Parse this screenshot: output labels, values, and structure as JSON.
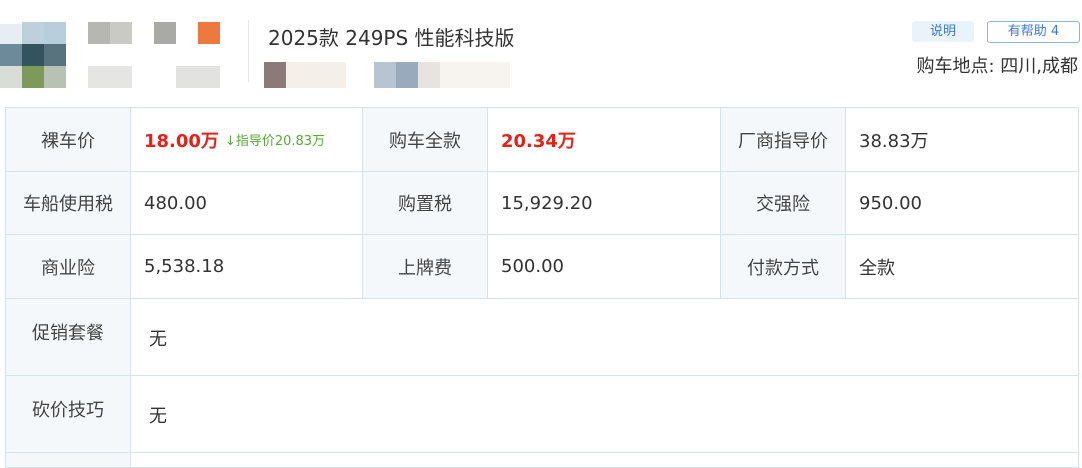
{
  "header": {
    "title": "2025款 249PS 性能科技版",
    "tags": {
      "explain": "说明",
      "helpful": "有帮助 4"
    },
    "location": "购车地点: 四川,成都"
  },
  "price_table": {
    "rows": [
      [
        {
          "label": "裸车价",
          "value": "18.00万",
          "highlight": true,
          "note": "↓指导价20.83万"
        },
        {
          "label": "购车全款",
          "value": "20.34万",
          "highlight": true
        },
        {
          "label": "厂商指导价",
          "value": "38.83万"
        }
      ],
      [
        {
          "label": "车船使用税",
          "value": "480.00"
        },
        {
          "label": "购置税",
          "value": "15,929.20"
        },
        {
          "label": "交强险",
          "value": "950.00"
        }
      ],
      [
        {
          "label": "商业险",
          "value": "5,538.18"
        },
        {
          "label": "上牌费",
          "value": "500.00"
        },
        {
          "label": "付款方式",
          "value": "全款"
        }
      ]
    ],
    "promo": {
      "label": "促销套餐",
      "value": "无"
    },
    "haggle": {
      "label": "砍价技巧",
      "value": "无"
    }
  },
  "colors": {
    "accent_red": "#e2231a",
    "discount_green": "#58a83a",
    "link_blue": "#3d7ad1",
    "label_bg": "#f5f8fb",
    "border": "#d2e3f1"
  }
}
